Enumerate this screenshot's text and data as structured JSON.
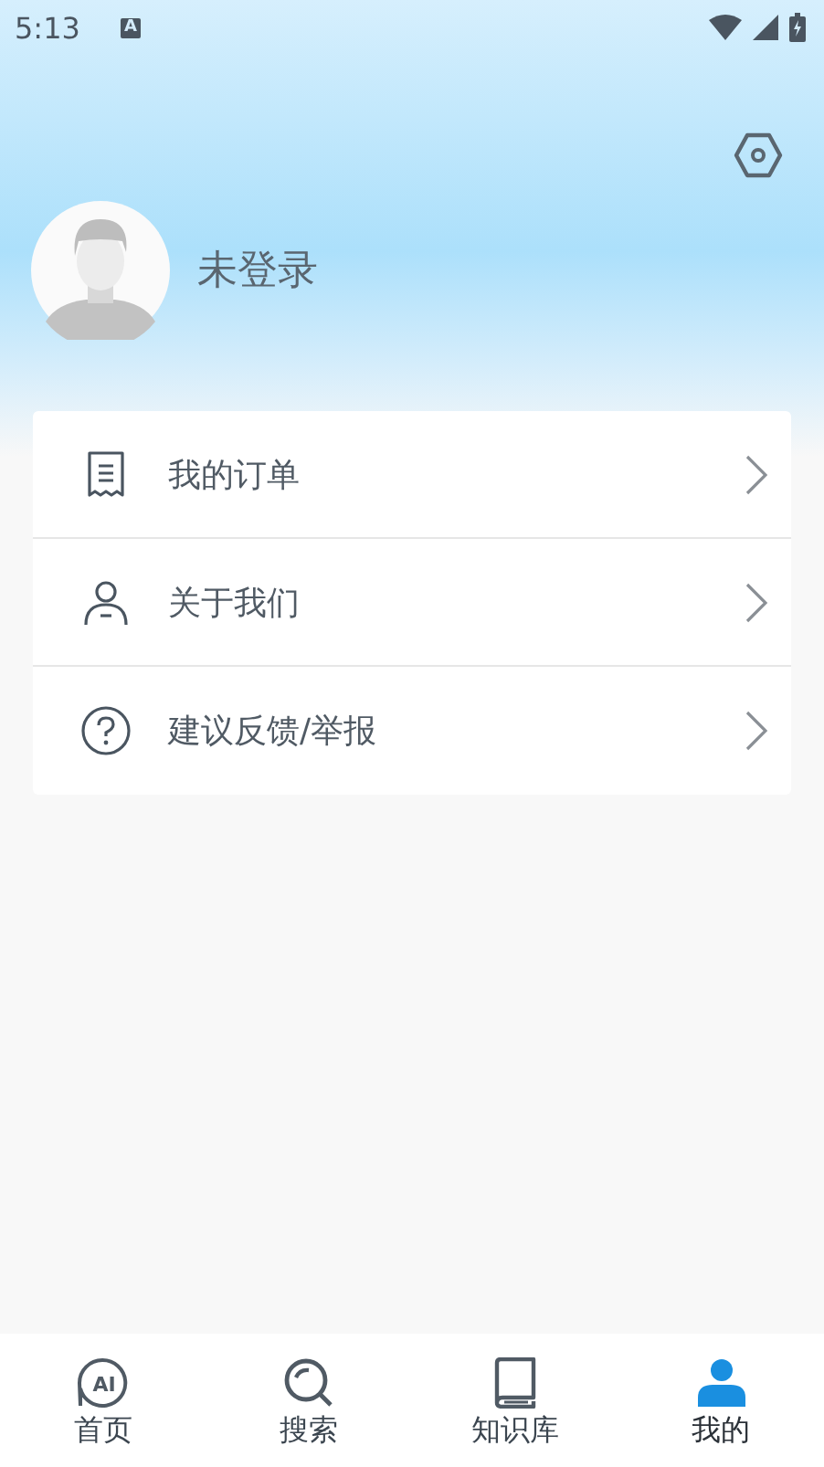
{
  "status_bar": {
    "time": "5:13",
    "notification_glyph": "A"
  },
  "profile": {
    "name": "未登录"
  },
  "menu": [
    {
      "kind": "receipt",
      "label": "我的订单"
    },
    {
      "kind": "person",
      "label": "关于我们"
    },
    {
      "kind": "question",
      "label": "建议反馈/举报"
    }
  ],
  "tabs": [
    {
      "kind": "ai",
      "label": "首页",
      "icon_text": "AI",
      "selected": false
    },
    {
      "kind": "search",
      "label": "搜索",
      "selected": false
    },
    {
      "kind": "book",
      "label": "知识库",
      "selected": false
    },
    {
      "kind": "person",
      "label": "我的",
      "selected": true
    }
  ]
}
